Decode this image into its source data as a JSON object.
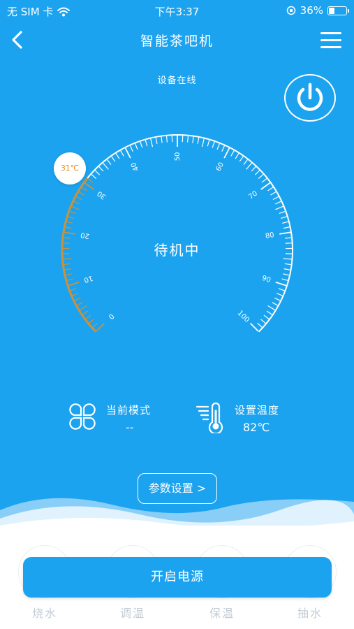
{
  "status_bar": {
    "carrier": "无 SIM 卡",
    "time": "下午3:37",
    "battery": "36%",
    "battery_level": 0.36
  },
  "nav": {
    "title": "智能茶吧机"
  },
  "device": {
    "online_status": "设备在线",
    "current_temp": "31℃",
    "current_temp_value": 31,
    "state": "待机中"
  },
  "gauge": {
    "min": 0,
    "max": 100,
    "tick_labels": [
      "0",
      "10",
      "20",
      "30",
      "40",
      "50",
      "60",
      "70",
      "80",
      "90",
      "100"
    ],
    "progress_color": "#c8923f",
    "accent": "#ffffff"
  },
  "info": {
    "mode_label": "当前模式",
    "mode_value": "--",
    "set_temp_label": "设置温度",
    "set_temp_value": "82℃"
  },
  "params_button": "参数设置 >",
  "modes": [
    {
      "label": "烧水"
    },
    {
      "label": "调温"
    },
    {
      "label": "保温"
    },
    {
      "label": "抽水"
    }
  ],
  "start_button": "开启电源",
  "colors": {
    "primary": "#1ca3ef",
    "temp_text": "#f08a1e",
    "mode_text": "#c3ccd5"
  }
}
